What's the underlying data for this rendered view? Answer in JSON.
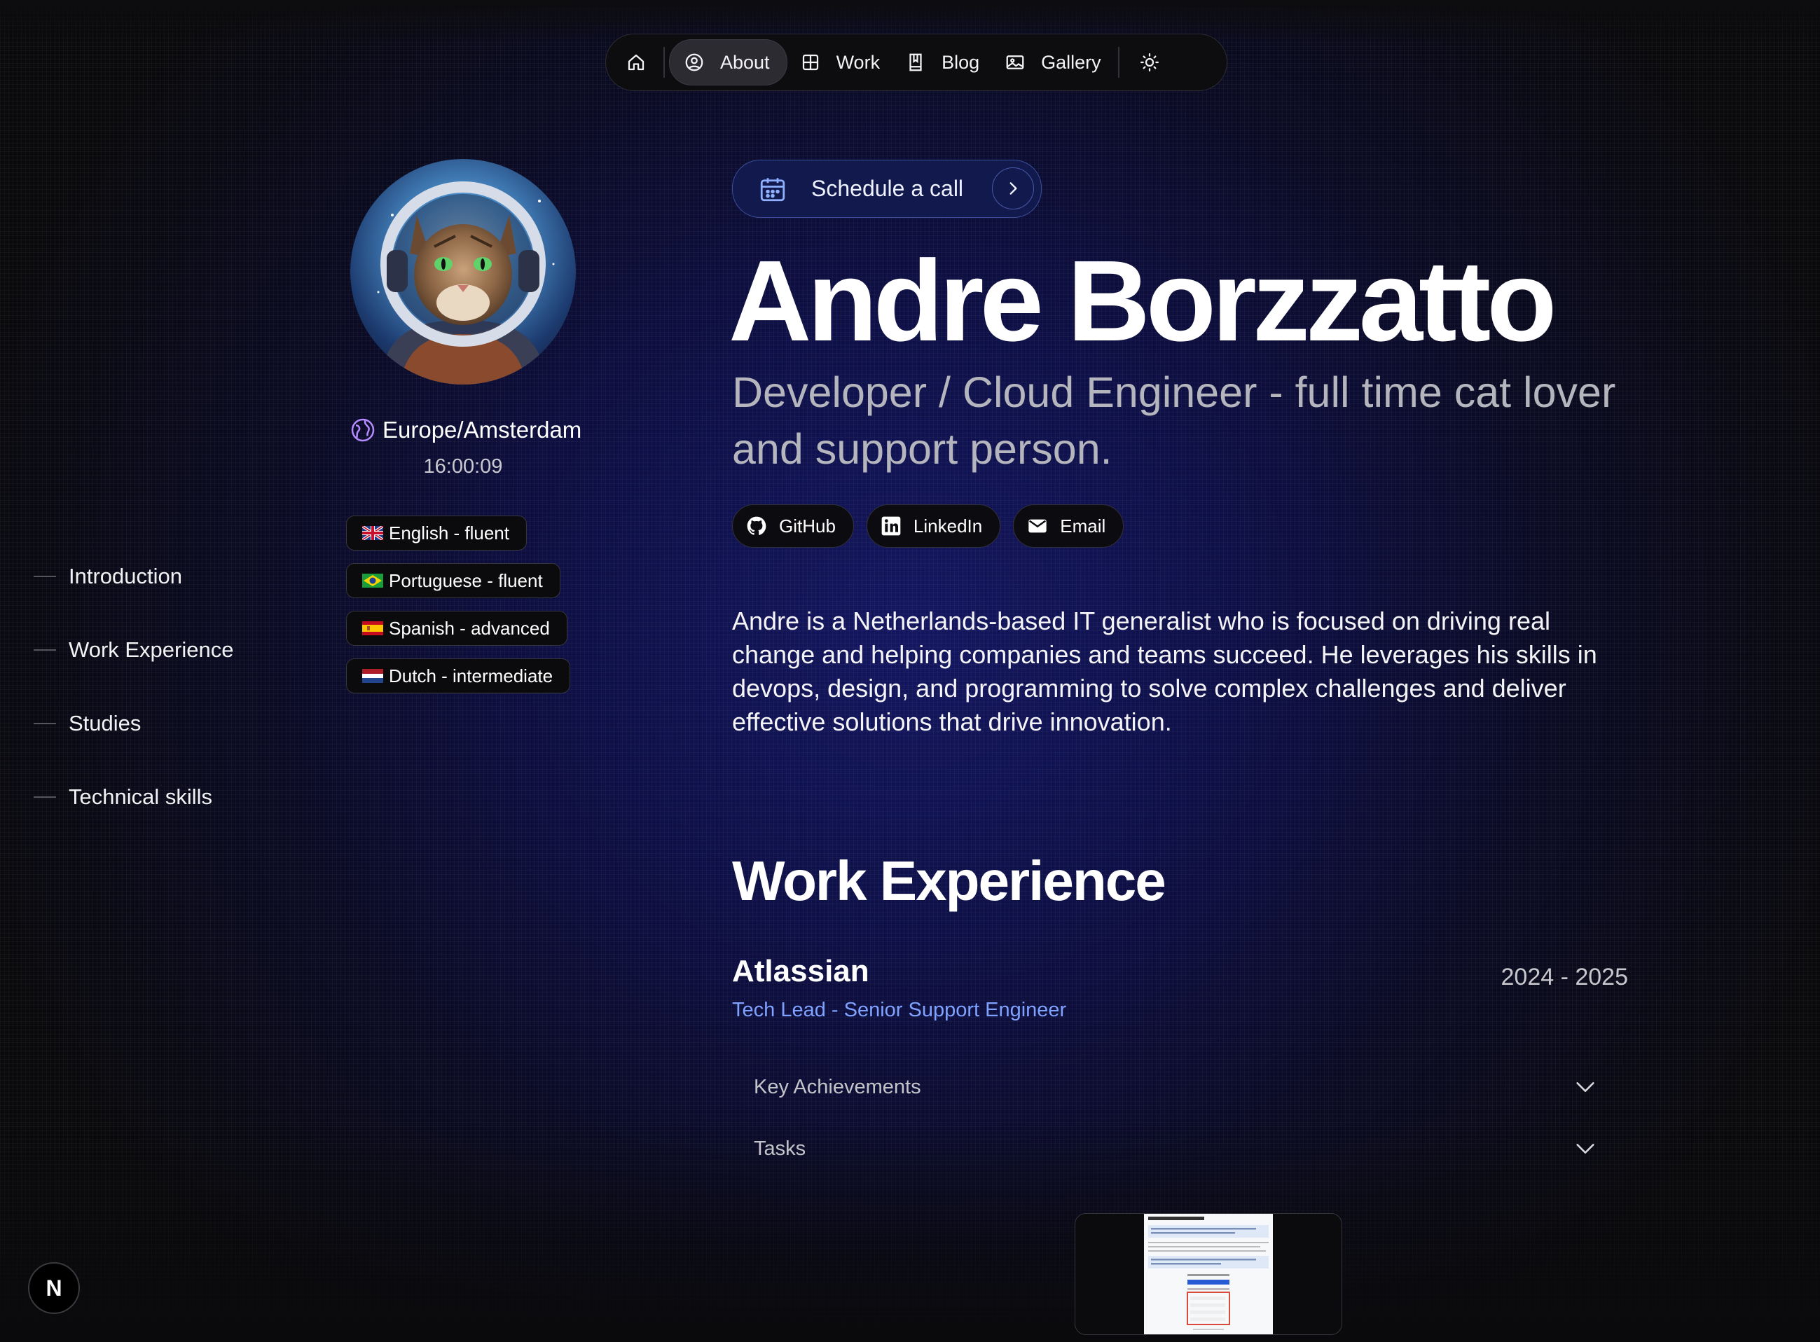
{
  "nav": {
    "items": [
      {
        "label": "About",
        "icon": "user-circle-icon"
      },
      {
        "label": "Work",
        "icon": "grid-icon"
      },
      {
        "label": "Blog",
        "icon": "book-icon"
      },
      {
        "label": "Gallery",
        "icon": "image-icon"
      }
    ],
    "active": "About"
  },
  "toc": [
    "Introduction",
    "Work Experience",
    "Studies",
    "Technical skills"
  ],
  "profile": {
    "location": "Europe/Amsterdam",
    "time": "16:00:09",
    "languages": [
      {
        "label": "English - fluent",
        "flag": "uk-flag-icon"
      },
      {
        "label": "Portuguese - fluent",
        "flag": "brazil-flag-icon"
      },
      {
        "label": "Spanish - advanced",
        "flag": "spain-flag-icon"
      },
      {
        "label": "Dutch - intermediate",
        "flag": "netherlands-flag-icon"
      }
    ]
  },
  "hero": {
    "schedule_label": "Schedule a call",
    "name": "Andre Borzzatto",
    "role": "Developer / Cloud Engineer - full time cat lover and support person.",
    "socials": [
      {
        "label": "GitHub",
        "icon": "github-icon"
      },
      {
        "label": "LinkedIn",
        "icon": "linkedin-icon"
      },
      {
        "label": "Email",
        "icon": "email-icon"
      }
    ],
    "bio": "Andre is a Netherlands-based IT generalist who is focused on driving real change and helping companies and teams succeed. He leverages his skills in devops, design, and programming to solve complex challenges and deliver effective solutions that drive innovation."
  },
  "work": {
    "title": "Work Experience",
    "company": "Atlassian",
    "dates": "2024 - 2025",
    "role": "Tech Lead - Senior Support Engineer",
    "accordions": [
      "Key Achievements",
      "Tasks"
    ]
  },
  "badge": {
    "label": "N"
  },
  "colors": {
    "accent": "#7fa2ff",
    "background": "#0a0a0c",
    "nav_bg": "#0d0d10"
  }
}
